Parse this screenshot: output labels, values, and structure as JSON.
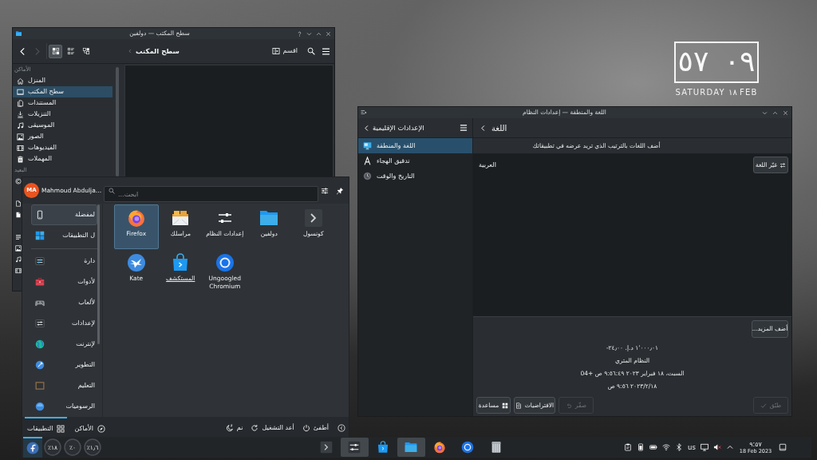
{
  "desktop_clock": {
    "time": "٠٩ ٥٧",
    "date": "SATURDAY ١٨ FEB"
  },
  "file_manager": {
    "title": "سطح المكتب — دولفين",
    "navigation": [
      {
        "kind": "back",
        "disabled": false
      },
      {
        "kind": "forward",
        "disabled": true
      }
    ],
    "view_modes": [
      {
        "kind": "icons",
        "selected": true
      },
      {
        "kind": "compact",
        "selected": false
      },
      {
        "kind": "details",
        "selected": false
      }
    ],
    "breadcrumb": "سطح المكتب",
    "split_button": "اقسم",
    "sidebar": [
      {
        "heading": "الأماكن",
        "items": [
          {
            "label": "المنزل",
            "kind": "home",
            "selected": false
          },
          {
            "label": "سطح المكتب",
            "kind": "desktop",
            "selected": true
          },
          {
            "label": "المستندات",
            "kind": "documents",
            "selected": false
          },
          {
            "label": "التنزيلات",
            "kind": "downloads",
            "selected": false
          },
          {
            "label": "الموسيقى",
            "kind": "music",
            "selected": false
          },
          {
            "label": "الصور",
            "kind": "pictures",
            "selected": false
          },
          {
            "label": "الفيديوهات",
            "kind": "videos",
            "selected": false
          },
          {
            "label": "المهملات",
            "kind": "trash",
            "selected": false
          }
        ]
      },
      {
        "heading": "البعيد",
        "items": [
          {
            "kind": "network",
            "selected": false
          }
        ]
      },
      {
        "items": [
          {
            "kind": "recent_files",
            "selected": false
          },
          {
            "kind": "recent_locations",
            "selected": false
          }
        ]
      },
      {
        "items": [
          {
            "kind": "search_documents",
            "selected": false
          },
          {
            "kind": "search_images",
            "selected": false
          },
          {
            "kind": "search_audio",
            "selected": false
          },
          {
            "kind": "search_videos",
            "selected": false
          }
        ]
      }
    ]
  },
  "settings": {
    "title": "اللغة والمنطقة — إعدادات النظام",
    "sidebar_title": "الإعدادات الإقليمية",
    "modules": [
      {
        "label": "اللغة والمنطقة",
        "kind": "region",
        "selected": true
      },
      {
        "label": "تدقيق الهجاء",
        "kind": "spelling",
        "selected": false
      },
      {
        "label": "التاريخ والوقت",
        "kind": "datetime",
        "selected": false
      }
    ],
    "page_title": "اللغة",
    "hint": "أضف اللغات بالترتيب الذي تريد عرضه في تطبيقاتك",
    "languages": [
      "العربية"
    ],
    "change_language_button": "غيّر اللغة",
    "add_more_button": "أضف المزيد...",
    "examples": [
      "١٬٠٠٠٫٠١ د.إ.‏ ٢٤٫٠٠-",
      "النظام المتري",
      "السبت، ١٨ فبراير ٢٠٢٣ ٩:٥٦:٤٩ ص +04",
      "٢٠٢٣/٢/١٨ ٩:٥٦ ص"
    ],
    "buttons": [
      {
        "label": "طبّق",
        "kind": "apply",
        "disabled": true
      },
      {
        "label": "صفّر",
        "kind": "reset",
        "disabled": true
      },
      {
        "label": "الافتراضيات",
        "kind": "defaults",
        "disabled": false
      },
      {
        "label": "مساعدة",
        "kind": "help",
        "disabled": false
      }
    ]
  },
  "start_menu": {
    "user": {
      "initials": "MA",
      "name": "Mahmoud Abdulja…"
    },
    "search_placeholder": "ابحث...",
    "pinned_categories": [
      {
        "label": "لمفضلة",
        "kind": "favorites",
        "selected": true
      },
      {
        "label": "ل التطبيقات",
        "kind": "all_apps",
        "selected": false
      }
    ],
    "categories": [
      {
        "label": "دارة",
        "kind": "admin",
        "selected": false
      },
      {
        "label": "لأدوات",
        "kind": "tools",
        "selected": false
      },
      {
        "label": "لألعاب",
        "kind": "games",
        "selected": false
      },
      {
        "label": "لإعدادات",
        "kind": "settings",
        "selected": false
      },
      {
        "label": "لإنترنت",
        "kind": "internet",
        "selected": false
      },
      {
        "label": "التطوير",
        "kind": "development",
        "selected": false
      },
      {
        "label": "التعليم",
        "kind": "education",
        "selected": false
      },
      {
        "label": "الرسوميات",
        "kind": "graphics",
        "selected": false
      }
    ],
    "apps": [
      {
        "label": "كونسول",
        "kind": "konsole",
        "selected": false,
        "hovered": false
      },
      {
        "label": "دولفين",
        "kind": "dolphin",
        "selected": false,
        "hovered": false
      },
      {
        "label": "إعدادات النظام",
        "kind": "system_settings",
        "selected": false,
        "hovered": false
      },
      {
        "label": "مراسلك",
        "kind": "mail",
        "selected": false,
        "hovered": false
      },
      {
        "label": "Firefox",
        "kind": "firefox",
        "selected": true,
        "hovered": false
      },
      {
        "label": "Ungoogled Chromium",
        "kind": "chromium",
        "selected": false,
        "hovered": false
      },
      {
        "label": "المستكشف",
        "kind": "discover",
        "selected": false,
        "hovered": true
      },
      {
        "label": "Kate",
        "kind": "kate",
        "selected": false,
        "hovered": false
      }
    ],
    "tabs": [
      {
        "label": "الأماكن",
        "kind": "places_tab",
        "selected": false
      },
      {
        "label": "التطبيقات",
        "kind": "apps_tab",
        "selected": true
      }
    ],
    "power_actions": [
      {
        "label": "أطفئ",
        "kind": "shutdown"
      },
      {
        "label": "أعد التشغيل",
        "kind": "restart"
      },
      {
        "label": "نم",
        "kind": "sleep"
      }
    ]
  },
  "taskbar": {
    "launcher_open": true,
    "monitors": [
      {
        "value": "١٫٦٪"
      },
      {
        "value": "٠٪"
      },
      {
        "value": "١٨٪"
      }
    ],
    "tasks": [
      {
        "kind": "konsole",
        "open": false
      },
      {
        "kind": "system_settings",
        "open": true
      },
      {
        "kind": "discover",
        "open": false
      },
      {
        "kind": "dolphin",
        "open": true
      },
      {
        "kind": "firefox",
        "open": false
      },
      {
        "kind": "chromium",
        "open": false
      },
      {
        "kind": "archive",
        "open": false
      }
    ],
    "tray": [
      {
        "kind": "clipboard"
      },
      {
        "kind": "device"
      },
      {
        "kind": "battery"
      },
      {
        "kind": "wifi"
      },
      {
        "kind": "bluetooth"
      },
      {
        "kind": "keyboard",
        "label": "us"
      },
      {
        "kind": "display"
      },
      {
        "kind": "volume",
        "muted": true
      },
      {
        "kind": "expand"
      }
    ],
    "time": "٩:٥٧",
    "date": "18 Feb 2023"
  }
}
